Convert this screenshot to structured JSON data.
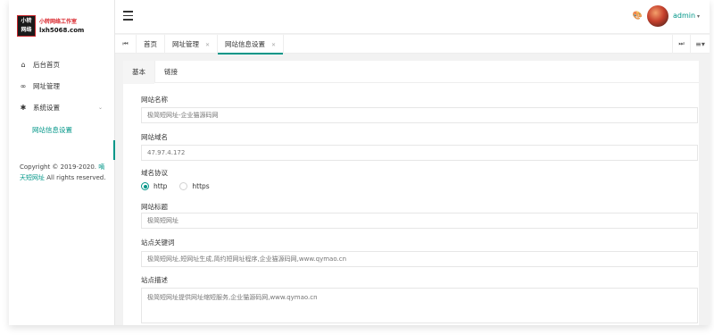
{
  "logo": {
    "line1": "小转",
    "line2": "网络",
    "tagline": "小转网络工作室",
    "domain": "lxh5068.com"
  },
  "sidebar": {
    "items": [
      {
        "label": "后台首页",
        "icon": "home-icon"
      },
      {
        "label": "网址管理",
        "icon": "link-icon"
      },
      {
        "label": "系统设置",
        "icon": "gear-icon"
      }
    ],
    "submenu": [
      {
        "label": "网站信息设置"
      }
    ]
  },
  "copyright": {
    "prefix": "Copyright © 2019-2020.",
    "link": "嘀天短网址",
    "suffix": "All rights reserved."
  },
  "header": {
    "user": "admin"
  },
  "tabs": [
    {
      "label": "首页"
    },
    {
      "label": "网址管理"
    },
    {
      "label": "网站信息设置"
    }
  ],
  "card": {
    "tabs": [
      {
        "label": "基本"
      },
      {
        "label": "链接"
      }
    ]
  },
  "form": {
    "site_name": {
      "label": "网站名称",
      "placeholder": "极简短网址-企业猫源码网"
    },
    "site_domain": {
      "label": "网站域名",
      "placeholder": "47.97.4.172"
    },
    "protocol": {
      "label": "域名协议",
      "options": [
        "http",
        "https"
      ],
      "selected": "http"
    },
    "site_title": {
      "label": "网站标题",
      "placeholder": "极简短网址"
    },
    "keywords": {
      "label": "站点关键词",
      "placeholder": "极简短网址,短网址生成,简约短网址程序,企业猫源码网,www.qymao.cn"
    },
    "description": {
      "label": "站点描述",
      "placeholder": "极简短网址提供网址缩短服务,企业猫源码网,www.qymao.cn"
    }
  },
  "colors": {
    "accent": "#009688"
  }
}
